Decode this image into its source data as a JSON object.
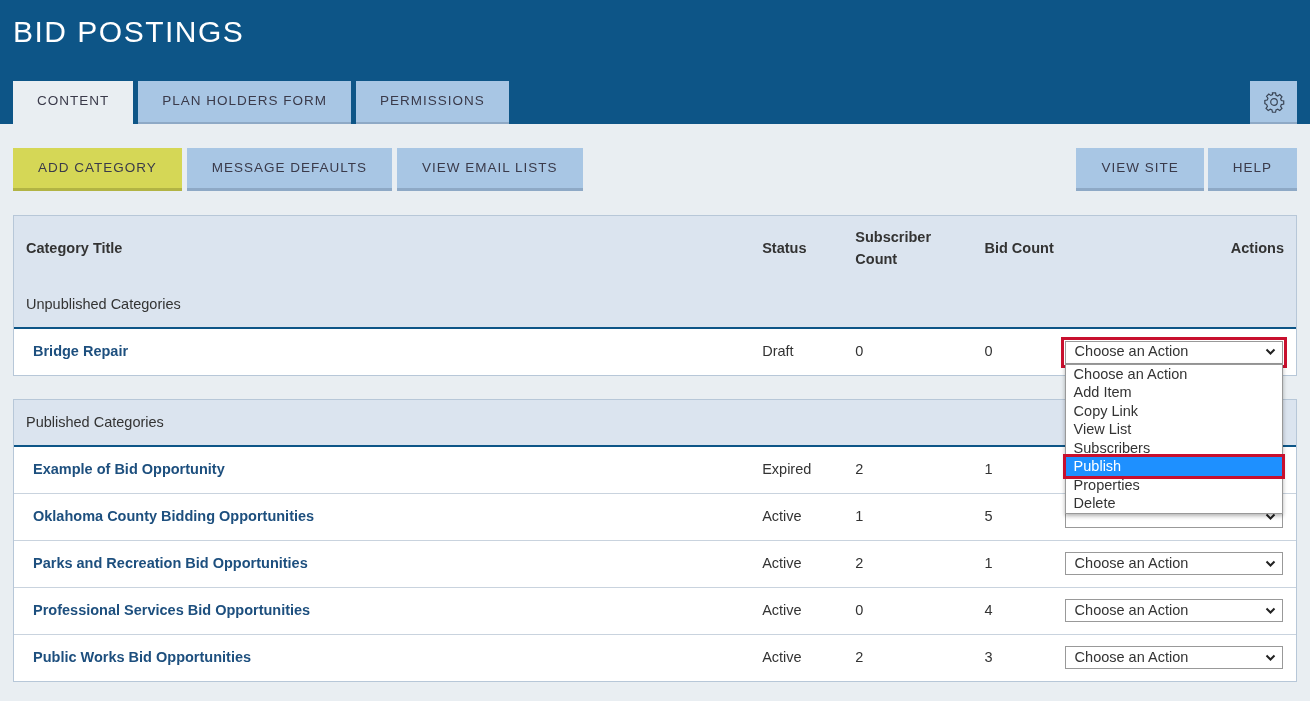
{
  "page": {
    "title": "BID POSTINGS"
  },
  "tabs": [
    {
      "label": "CONTENT",
      "selected": true
    },
    {
      "label": "PLAN HOLDERS FORM",
      "selected": false
    },
    {
      "label": "PERMISSIONS",
      "selected": false
    }
  ],
  "toolbar_left": [
    {
      "label": "ADD CATEGORY",
      "kind": "primary"
    },
    {
      "label": "MESSAGE DEFAULTS",
      "kind": "secondary"
    },
    {
      "label": "VIEW EMAIL LISTS",
      "kind": "secondary"
    }
  ],
  "toolbar_right": [
    {
      "label": "VIEW SITE",
      "kind": "secondary"
    },
    {
      "label": "HELP",
      "kind": "secondary"
    }
  ],
  "table": {
    "columns": [
      "Category Title",
      "Status",
      "Subscriber Count",
      "Bid Count",
      "Actions"
    ],
    "sections": [
      {
        "heading": "Unpublished Categories",
        "rows": [
          {
            "title": "Bridge Repair",
            "status": "Draft",
            "subscribers": "0",
            "bids": "0",
            "kind": "select",
            "action": "Choose an Action",
            "highlighted": true,
            "options": [
              {
                "label": "Choose an Action",
                "selected": false,
                "highlighted": false
              },
              {
                "label": "Add Item",
                "selected": false,
                "highlighted": false
              },
              {
                "label": "Copy Link",
                "selected": false,
                "highlighted": false
              },
              {
                "label": "View List",
                "selected": false,
                "highlighted": false
              },
              {
                "label": "Subscribers",
                "selected": false,
                "highlighted": false
              },
              {
                "label": "Publish",
                "selected": true,
                "highlighted": true
              },
              {
                "label": "Properties",
                "selected": false,
                "highlighted": false
              },
              {
                "label": "Delete",
                "selected": false,
                "highlighted": false
              }
            ]
          }
        ]
      },
      {
        "heading": "Published Categories",
        "rows": [
          {
            "title": "Example of Bid Opportunity",
            "status": "Expired",
            "subscribers": "2",
            "bids": "1",
            "kind": "plain"
          },
          {
            "title": "Oklahoma County Bidding Opportunities",
            "status": "Active",
            "subscribers": "1",
            "bids": "5",
            "kind": "select"
          },
          {
            "title": "Parks and Recreation Bid Opportunities",
            "status": "Active",
            "subscribers": "2",
            "bids": "1",
            "kind": "select",
            "action": "Choose an Action"
          },
          {
            "title": "Professional Services Bid Opportunities",
            "status": "Active",
            "subscribers": "0",
            "bids": "4",
            "kind": "select",
            "action": "Choose an Action"
          },
          {
            "title": "Public Works Bid Opportunities",
            "status": "Active",
            "subscribers": "2",
            "bids": "3",
            "kind": "select",
            "action": "Choose an Action"
          }
        ]
      }
    ]
  }
}
